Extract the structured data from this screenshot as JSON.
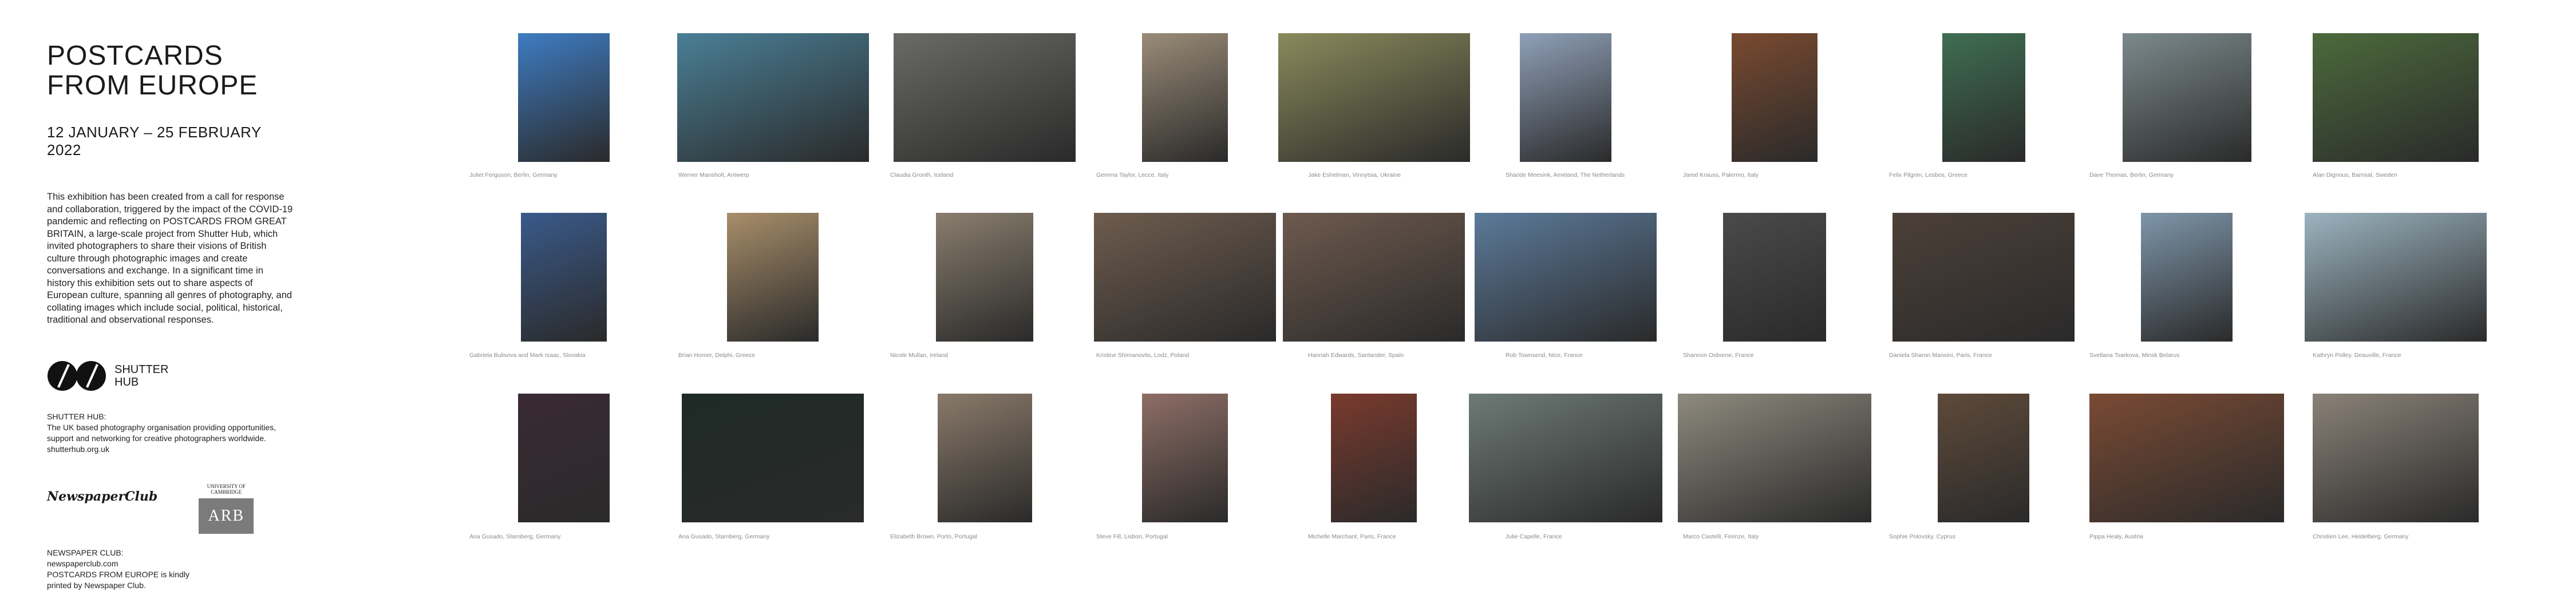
{
  "info": {
    "title_line1": "POSTCARDS",
    "title_line2": "FROM EUROPE",
    "dates": "12 JANUARY – 25 FEBRUARY 2022",
    "intro": "This exhibition has been created from a call for response and collaboration, triggered by the impact of the COVID-19 pandemic and reflecting on POSTCARDS FROM GREAT BRITAIN, a large-scale project from Shutter Hub, which invited photographers to share their visions of British culture through photographic images and create conversations and exchange. In a significant time in history this exhibition sets out to share aspects of European culture, spanning all genres of photography, and collating images which include social, political, historical, traditional and observational responses.",
    "brand_line1": "SHUTTER",
    "brand_line2": "HUB",
    "org_name": "SHUTTER HUB:",
    "org_desc_1": "The UK based photography organisation providing opportunities,",
    "org_desc_2": "support and networking for creative photographers worldwide.",
    "org_url": "shutterhub.org.uk",
    "newspaper_logo": "NewspaperClub",
    "arb_uni": "UNIVERSITY OF CAMBRIDGE",
    "arb_logo": "ARB",
    "nc_name": "NEWSPAPER CLUB:",
    "nc_url": "newspaperclub.com",
    "nc_line1": "POSTCARDS FROM EUROPE is kindly",
    "nc_line2": "printed by Newspaper Club."
  },
  "photos": [
    {
      "caption": "Juliet Ferguson, Berlin, Germany",
      "color": "#3e7cc2"
    },
    {
      "caption": "Werner Mansholt, Antwerp",
      "color": "#4a7f96"
    },
    {
      "caption": "Claudia Gronth, Iceland",
      "color": "#6a6a66"
    },
    {
      "caption": "Gemma Taylor, Lecce, Italy",
      "color": "#9a8c78"
    },
    {
      "caption": "Jake Eshelman, Vinnytsia, Ukraine",
      "color": "#8a8a5c"
    },
    {
      "caption": "Sharide Meesink, Ameland, The Netherlands",
      "color": "#8fa0b8"
    },
    {
      "caption": "Jared Krauss, Palermo, Italy",
      "color": "#7a4a30"
    },
    {
      "caption": "Felix Pilgrim, Lesbos, Greece",
      "color": "#3f6e52"
    },
    {
      "caption": "Dave Thomas, Berlin, Germany",
      "color": "#7c8a8c"
    },
    {
      "caption": "Alan Dignous, Barnsal, Sweden",
      "color": "#4c6a3c"
    },
    {
      "caption": "Gabriela Bulisova and Mark Isaac, Slovakia",
      "color": "#3a5a8a"
    },
    {
      "caption": "Brian Homer, Delphi, Greece",
      "color": "#a88e6a"
    },
    {
      "caption": "Nicole Mullan, Ireland",
      "color": "#8a7e6e"
    },
    {
      "caption": "Kristine Shimanovits, Lodz, Poland",
      "color": "#6e5c4e"
    },
    {
      "caption": "Hannah Edwards, Santander, Spain",
      "color": "#6e5a4e"
    },
    {
      "caption": "Rob Townsend, Nice, France",
      "color": "#5c7a9a"
    },
    {
      "caption": "Shannon Osborne, France",
      "color": "#4a4a4a"
    },
    {
      "caption": "Daniela Sharon Mansini, Paris, France",
      "color": "#4c4038"
    },
    {
      "caption": "Svetlana Tsarkova, Minsk Belarus",
      "color": "#7e96aa"
    },
    {
      "caption": "Kathryn Polley, Deauville, France",
      "color": "#9cb4c0"
    },
    {
      "caption": "Ana Gusado, Starnberg, Germany",
      "color": "#3a2a34"
    },
    {
      "caption": "Ana Gusado, Starnberg, Germany",
      "color": "#1e2a26"
    },
    {
      "caption": "Elizabeth Brown, Porto, Portugal",
      "color": "#8a7a6a"
    },
    {
      "caption": "Steve Fill, Lisbon, Portugal",
      "color": "#8e6e66"
    },
    {
      "caption": "Michelle Marchant, Paris, France",
      "color": "#7a3a2e"
    },
    {
      "caption": "Julie Capelle, France",
      "color": "#6e7a76"
    },
    {
      "caption": "Marco Castelli, Firenze, Italy",
      "color": "#8e8a7e"
    },
    {
      "caption": "Sophie Polovsky, Cyprus",
      "color": "#5e4a3a"
    },
    {
      "caption": "Pippa Healy, Austria",
      "color": "#7a4a34"
    },
    {
      "caption": "Christien Lee, Heidelberg, Germany",
      "color": "#8a8278"
    }
  ]
}
